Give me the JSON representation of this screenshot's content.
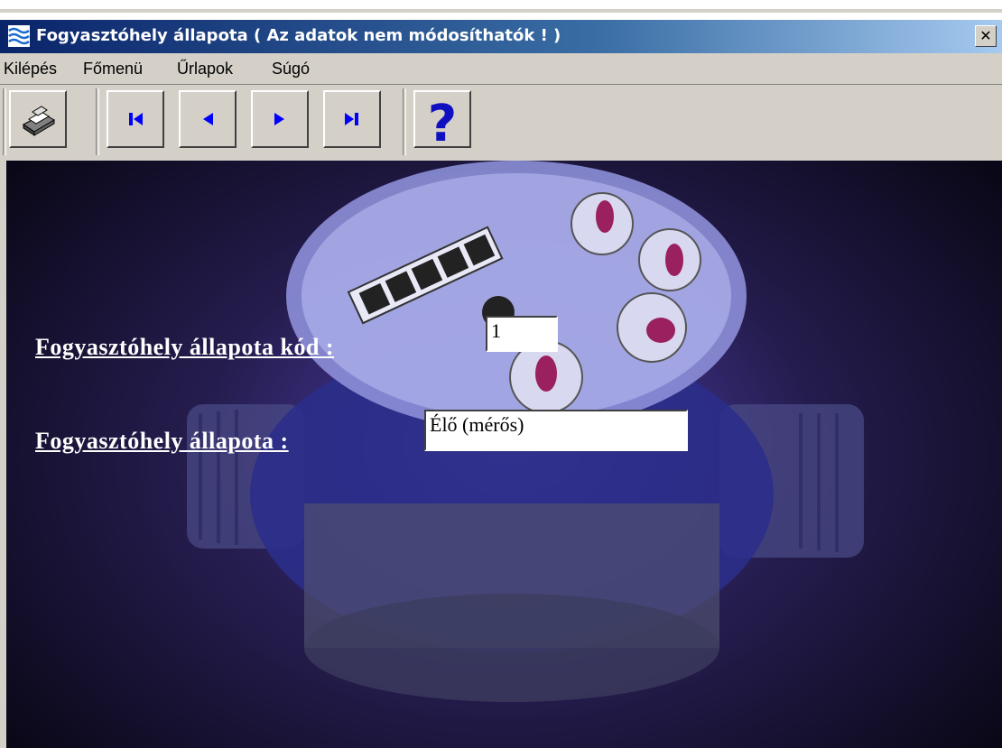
{
  "window": {
    "title": "Fogyasztóhely állapota  ( Az adatok nem módosíthatók ! )",
    "close_glyph": "✕"
  },
  "menu": {
    "items": [
      "Kilépés",
      "Főmenü",
      "Űrlapok",
      "Súgó"
    ]
  },
  "toolbar": {
    "buttons": [
      "print-icon",
      "first-record-icon",
      "previous-record-icon",
      "next-record-icon",
      "last-record-icon",
      "help-icon"
    ],
    "help_glyph": "?"
  },
  "form": {
    "code_label": "Fogyasztóhely állapota kód :",
    "code_value": "1",
    "status_label": "Fogyasztóhely állapota :",
    "status_value": "Élő (mérős)"
  },
  "colors": {
    "titlebar_start": "#0a246a",
    "titlebar_end": "#a6caf0",
    "face": "#d4d0c8",
    "nav_arrow": "#0000ff",
    "help": "#1010c0"
  }
}
